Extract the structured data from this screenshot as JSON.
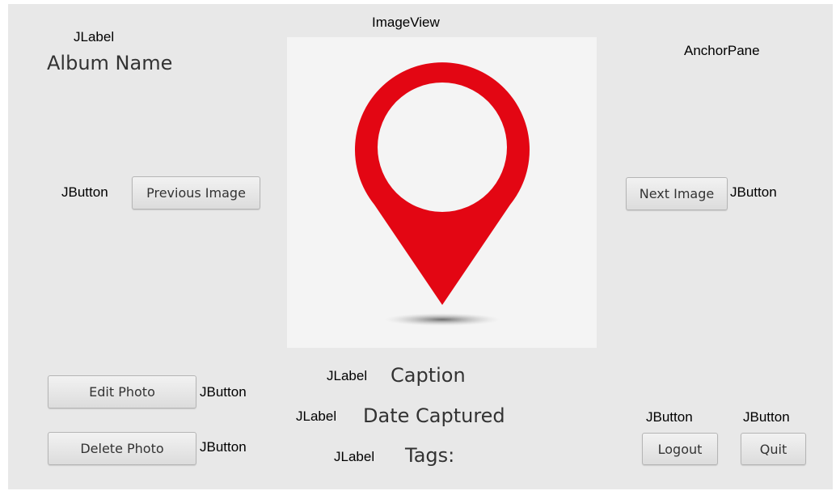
{
  "annotations": {
    "imageview": "ImageView",
    "anchorpane": "AnchorPane",
    "album_label": "JLabel",
    "previous_button": "JButton",
    "next_button": "JButton",
    "edit_button": "JButton",
    "delete_button": "JButton",
    "caption_label": "JLabel",
    "date_label": "JLabel",
    "tags_label": "JLabel",
    "logout_button": "JButton",
    "quit_button": "JButton"
  },
  "album": {
    "name": "Album Name"
  },
  "navigation": {
    "previous_label": "Previous Image",
    "next_label": "Next Image"
  },
  "photo": {
    "caption": "Caption",
    "date": "Date Captured",
    "tags": "Tags:",
    "pin_color": "#e30613"
  },
  "actions": {
    "edit_label": "Edit Photo",
    "delete_label": "Delete Photo",
    "logout_label": "Logout",
    "quit_label": "Quit"
  },
  "icons": [
    "location-pin-icon"
  ]
}
